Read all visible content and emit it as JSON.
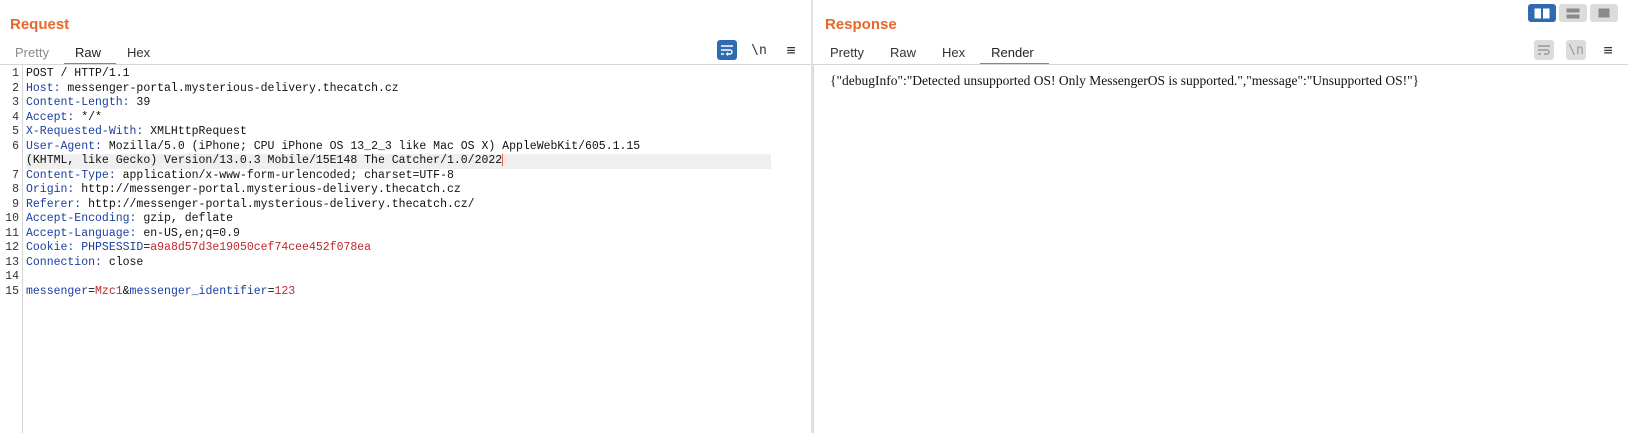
{
  "request": {
    "title": "Request",
    "tabs": [
      {
        "label": "Pretty"
      },
      {
        "label": "Raw"
      },
      {
        "label": "Hex"
      }
    ],
    "toolbar": {
      "wrap_icon": "wrap-lines-icon",
      "newline_label": "\\n",
      "menu_icon": "hamburger-menu-icon"
    },
    "lines": [
      {
        "num": "1",
        "text": "POST / HTTP/1.1"
      },
      {
        "num": "2",
        "name": "Host:",
        "value": " messenger-portal.mysterious-delivery.thecatch.cz"
      },
      {
        "num": "3",
        "name": "Content-Length:",
        "value": " 39"
      },
      {
        "num": "4",
        "name": "Accept:",
        "value": " */*"
      },
      {
        "num": "5",
        "name": "X-Requested-With:",
        "value": " XMLHttpRequest"
      },
      {
        "num": "6",
        "name": "User-Agent:",
        "value": " Mozilla/5.0 (iPhone; CPU iPhone OS 13_2_3 like Mac OS X) AppleWebKit/605.1.15"
      },
      {
        "num": "",
        "text": "(KHTML, like Gecko) Version/13.0.3 Mobile/15E148 The Catcher/1.0/2022"
      },
      {
        "num": "7",
        "name": "Content-Type:",
        "value": " application/x-www-form-urlencoded; charset=UTF-8"
      },
      {
        "num": "8",
        "name": "Origin:",
        "value": " http://messenger-portal.mysterious-delivery.thecatch.cz"
      },
      {
        "num": "9",
        "name": "Referer:",
        "value": " http://messenger-portal.mysterious-delivery.thecatch.cz/"
      },
      {
        "num": "10",
        "name": "Accept-Encoding:",
        "value": " gzip, deflate"
      },
      {
        "num": "11",
        "name": "Accept-Language:",
        "value": " en-US,en;q=0.9"
      },
      {
        "num": "12",
        "name": "Cookie:",
        "cookie_name": " PHPSESSID",
        "cookie_eq": "=",
        "cookie_value": "a9a8d57d3e19050cef74cee452f078ea"
      },
      {
        "num": "13",
        "name": "Connection:",
        "value": " close"
      },
      {
        "num": "14",
        "text": ""
      },
      {
        "num": "15",
        "p1_name": "messenger",
        "p1_val": "Mzc1",
        "amp": "&",
        "p2_name": "messenger_identifier",
        "p2_val": "123"
      }
    ]
  },
  "response": {
    "title": "Response",
    "tabs": [
      {
        "label": "Pretty"
      },
      {
        "label": "Raw"
      },
      {
        "label": "Hex"
      },
      {
        "label": "Render"
      }
    ],
    "toolbar": {
      "wrap_icon": "wrap-lines-icon",
      "newline_label": "\\n",
      "menu_icon": "hamburger-menu-icon"
    },
    "render_body": "{\"debugInfo\":\"Detected unsupported OS! Only MessengerOS is supported.\",\"message\":\"Unsupported OS!\"}"
  },
  "view_switch": [
    "split-horizontal-icon",
    "split-vertical-icon",
    "single-pane-icon"
  ],
  "colors": {
    "accent": "#e8672a",
    "blue": "#2f6bb3",
    "header_name": "#1a3fa0",
    "value_red": "#c0282c"
  }
}
